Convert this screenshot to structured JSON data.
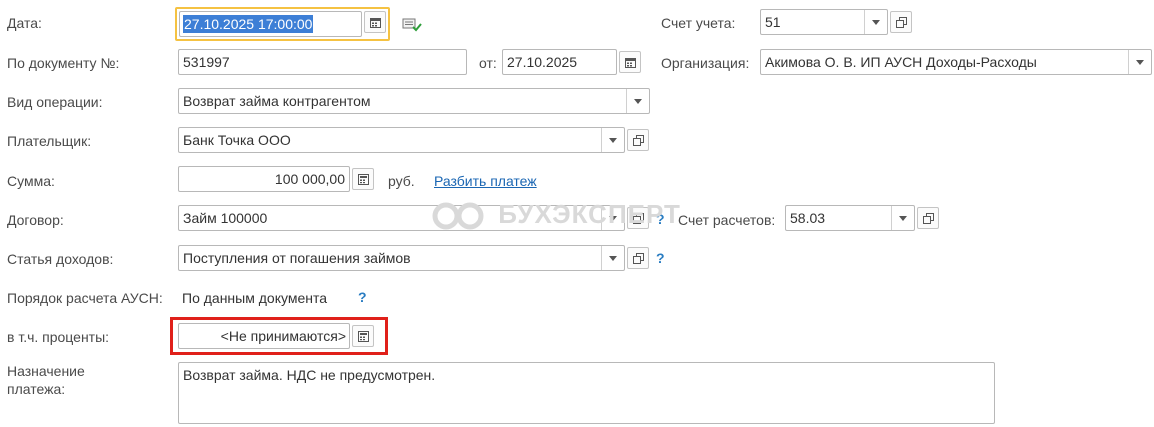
{
  "date": {
    "label": "Дата:",
    "value": "27.10.2025 17:00:00"
  },
  "account": {
    "label": "Счет учета:",
    "value": "51"
  },
  "doc_number": {
    "label": "По документу №:",
    "value": "531997",
    "from_label": "от:",
    "from_value": "27.10.2025"
  },
  "organization": {
    "label": "Организация:",
    "value": "Акимова О. В. ИП АУСН Доходы-Расходы"
  },
  "operation": {
    "label": "Вид операции:",
    "value": "Возврат займа контрагентом"
  },
  "payer": {
    "label": "Плательщик:",
    "value": "Банк Точка ООО"
  },
  "amount": {
    "label": "Сумма:",
    "value": "100 000,00",
    "currency": "руб.",
    "split_link": "Разбить платеж"
  },
  "contract": {
    "label": "Договор:",
    "value": "Займ 100000",
    "help": "?"
  },
  "settlement_account": {
    "label": "Счет расчетов:",
    "value": "58.03"
  },
  "income_item": {
    "label": "Статья доходов:",
    "value": "Поступления от погашения займов",
    "help": "?"
  },
  "ausn_order": {
    "label": "Порядок расчета АУСН:",
    "value": "По данным документа",
    "help": "?"
  },
  "interest": {
    "label": "в т.ч. проценты:",
    "value": "<Не принимаются>"
  },
  "purpose": {
    "label_line1": "Назначение",
    "label_line2": "платежа:",
    "value": "Возврат займа. НДС не предусмотрен."
  },
  "watermark": "БУХЭКСПЕРТ",
  "colors": {
    "focus_border": "#f5c242",
    "highlight_red": "#e0201a",
    "selection": "#3d7fd6",
    "link": "#1a66b3"
  }
}
